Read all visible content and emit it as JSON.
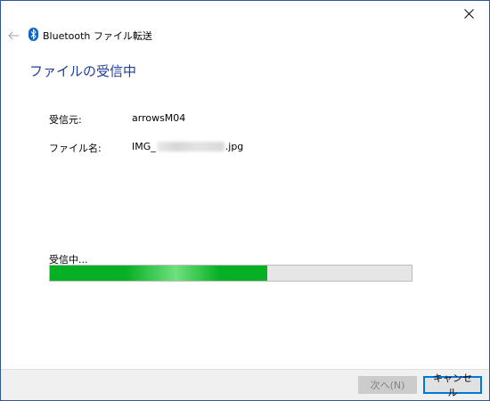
{
  "window": {
    "title": "Bluetooth ファイル転送",
    "heading": "ファイルの受信中"
  },
  "icons": {
    "close": "close-icon",
    "back": "back-arrow-icon",
    "bluetooth": "bluetooth-icon"
  },
  "fields": {
    "sender_label": "受信元:",
    "sender_value": "arrowsM04",
    "filename_label": "ファイル名:",
    "filename_prefix": "IMG_",
    "filename_suffix": ".jpg"
  },
  "transfer": {
    "status_text": "受信中...",
    "progress_fraction": 0.6
  },
  "buttons": {
    "next_label": "次へ(N)",
    "cancel_label": "キャンセル"
  },
  "colors": {
    "accent": "#0078d7",
    "heading": "#1e3f9e",
    "progress": "#06b025"
  }
}
